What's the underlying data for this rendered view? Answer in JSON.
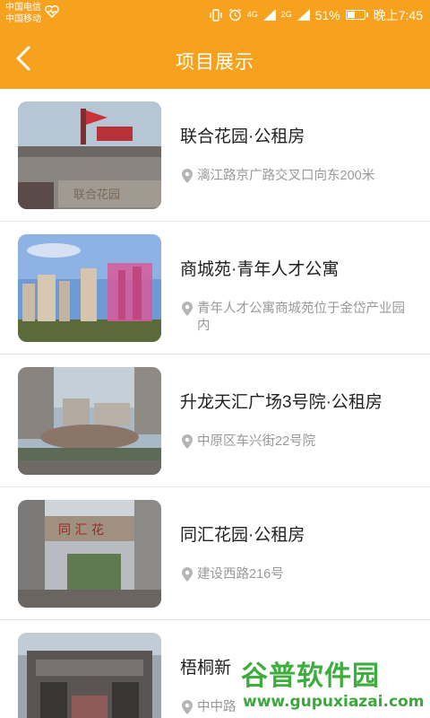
{
  "status_bar": {
    "carrier_1": "中国电信",
    "carrier_2": "中国移动",
    "net_a": "4G",
    "net_b": "2G",
    "battery_text": "51%",
    "battery_level": 0.51,
    "time": "晚上7:45"
  },
  "header": {
    "title": "项目展示"
  },
  "items": [
    {
      "title": "联合花园·公租房",
      "address": "漓江路京广路交叉口向东200米"
    },
    {
      "title": "商城苑·青年人才公寓",
      "address": "青年人才公寓商城苑位于金岱产业园内"
    },
    {
      "title": "升龙天汇广场3号院·公租房",
      "address": "中原区车兴街22号院"
    },
    {
      "title": "同汇花园·公租房",
      "address": "建设西路216号"
    },
    {
      "title": "梧桐新",
      "address": "中中路"
    }
  ],
  "watermark": {
    "text": "谷普软件园",
    "url": "www.gupuxiazai.com"
  },
  "colors": {
    "brand_orange": "#f7a21e",
    "title_text": "#222222",
    "address_text": "#999999"
  }
}
